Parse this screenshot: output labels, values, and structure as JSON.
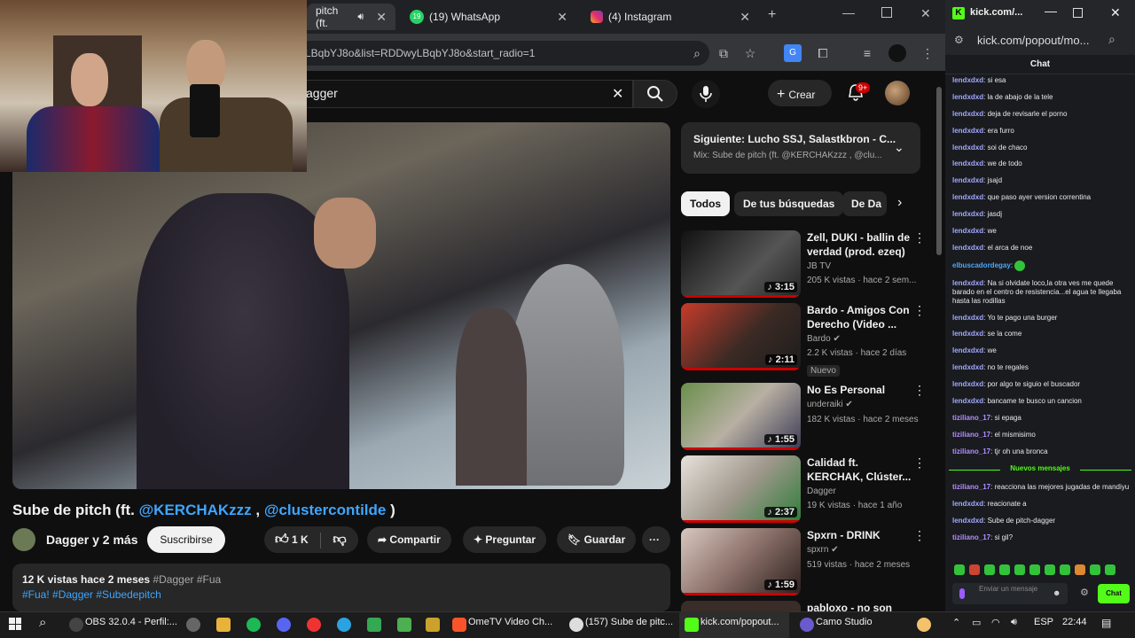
{
  "tabs": {
    "tab1": "pitch (ft. ",
    "tab2": "(19) WhatsApp",
    "tab3": "(4) Instagram",
    "whatsapp_badge": "19"
  },
  "omnibox": {
    "url": "LBqbYJ8o&list=RDDwyLBqbYJ8o&start_radio=1"
  },
  "youtube": {
    "search_value": "agger",
    "create_label": "Crear",
    "notif_badge": "9+",
    "video": {
      "title_prefix": "Sube de pitch (ft. ",
      "mention1": "@KERCHAKzzz",
      "sep": " , ",
      "mention2": "@clustercontilde",
      "title_suffix": " )",
      "channel": "Dagger y 2 más",
      "subscribe": "Suscribirse",
      "likes": "1 K",
      "share": "Compartir",
      "ask": "Preguntar",
      "save": "Guardar",
      "more": "···",
      "desc_stats": "12 K vistas  hace 2 meses",
      "desc_tags": "#Dagger #Fua",
      "desc_links": "#Fua! #Dagger #Subedepitch"
    },
    "upnext": {
      "title": "Siguiente: Lucho SSJ, Salastkbron - C...",
      "sub": "Mix: Sube de pitch (ft. @KERCHAKzzz , @clu..."
    },
    "chips": [
      "Todos",
      "De tus búsquedas",
      "De Da"
    ],
    "recs": [
      {
        "title": "Zell, DUKI - ballin de verdad (prod. ezeq)",
        "channel": "JB TV",
        "meta": "205 K vistas · hace 2 sem...",
        "duration": "♪ 3:15"
      },
      {
        "title": "Bardo - Amigos Con Derecho (Video ...",
        "channel": "Bardo",
        "meta": "2.2 K vistas · hace 2 días",
        "duration": "♪ 2:11",
        "tag": "Nuevo"
      },
      {
        "title": "No Es Personal",
        "channel": "underaiki",
        "meta": "182 K vistas · hace 2 meses",
        "duration": "♪ 1:55"
      },
      {
        "title": "Calidad ft. KERCHAK, Clúster...",
        "channel": "Dagger",
        "meta": "19 K vistas · hace 1 año",
        "duration": "♪ 2:37"
      },
      {
        "title": "Spxrn - DRINK",
        "channel": "spxrn",
        "meta": "519 vistas · hace 2 meses",
        "duration": "♪ 1:59"
      },
      {
        "title": "pabloxo - no son",
        "channel": "",
        "meta": "",
        "duration": ""
      }
    ]
  },
  "kick": {
    "window_title": "kick.com/...",
    "url": "kick.com/popout/mo...",
    "chat_label": "Chat",
    "messages": [
      {
        "user": "lendxdxd",
        "text": "si esa"
      },
      {
        "user": "lendxdxd",
        "text": "la de abajo de la tele"
      },
      {
        "user": "lendxdxd",
        "text": "deja de revisarle el porno"
      },
      {
        "user": "lendxdxd",
        "text": "era furro"
      },
      {
        "user": "lendxdxd",
        "text": "soi de chaco"
      },
      {
        "user": "lendxdxd",
        "text": "we de todo"
      },
      {
        "user": "lendxdxd",
        "text": "jsajd"
      },
      {
        "user": "lendxdxd",
        "text": "que paso ayer version correntina"
      },
      {
        "user": "lendxdxd",
        "text": "jasdj"
      },
      {
        "user": "lendxdxd",
        "text": "we"
      },
      {
        "user": "lendxdxd",
        "text": "el arca de noe"
      },
      {
        "user": "elbuscadordegay",
        "text": ""
      },
      {
        "user": "lendxdxd",
        "text": "Na si olvidate loco,la otra ves me quede barado en el centro de resistencia...el agua te llegaba hasta las rodillas"
      },
      {
        "user": "lendxdxd",
        "text": "Yo te pago una burger"
      },
      {
        "user": "lendxdxd",
        "text": "se la come"
      },
      {
        "user": "lendxdxd",
        "text": "we"
      },
      {
        "user": "lendxdxd",
        "text": "no te regales"
      },
      {
        "user": "lendxdxd",
        "text": "por algo te siguio el buscador"
      },
      {
        "user": "lendxdxd",
        "text": "bancame te busco un cancion"
      },
      {
        "user": "tiziliano_17",
        "text": "si epaga"
      },
      {
        "user": "tiziliano_17",
        "text": "el mismisimo"
      },
      {
        "user": "tiziliano_17",
        "text": "tjr oh una bronca"
      }
    ],
    "new_messages": "Nuevos mensajes",
    "messages2": [
      {
        "user": "tiziliano_17",
        "text": "reacciona las mejores jugadas de mandiyu"
      },
      {
        "user": "lendxdxd",
        "text": "reacionate a"
      },
      {
        "user": "lendxdxd",
        "text": "Sube de pitch-dagger"
      },
      {
        "user": "tiziliano_17",
        "text": "si gil?"
      }
    ],
    "input_placeholder": "Enviar un mensaje",
    "send_label": "Chat"
  },
  "taskbar": {
    "obs": "OBS 32.0.4 - Perfil:...",
    "ometv": "OmeTV Video Ch...",
    "yt": "(157) Sube de pitc...",
    "kick": "kick.com/popout...",
    "camo": "Camo Studio",
    "lang": "ESP",
    "time": "22:44"
  }
}
